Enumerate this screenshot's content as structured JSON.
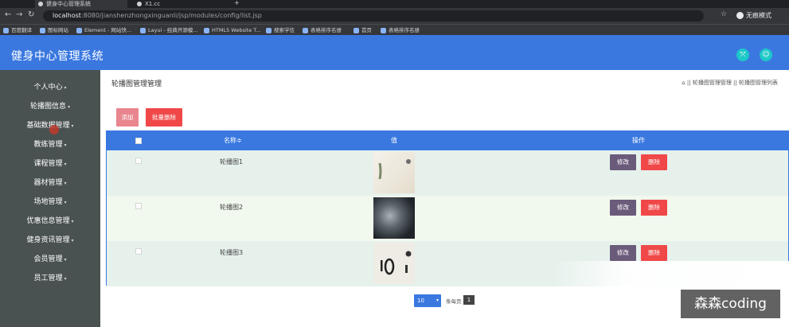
{
  "browser": {
    "tabs": [
      {
        "title": "健身中心管理系统",
        "active": true
      },
      {
        "title": "X1.cc",
        "active": false
      }
    ],
    "new_tab": "+",
    "url_host": "localhost",
    "url_path": ":8080/jianshenzhongxinguanli/jsp/modules/config/list.jsp",
    "incognito_label": "无痕模式",
    "bookmarks": [
      "百度翻译",
      "图标网站",
      "Element - 网站快...",
      "Layui - 经典开源模...",
      "HTML5 Website T...",
      "搜索学伍",
      "表格排序名册",
      "首页",
      "表格排序名册"
    ]
  },
  "header": {
    "title": "健身中心管理系统"
  },
  "sidebar": {
    "items": [
      {
        "label": "个人中心"
      },
      {
        "label": "轮播图信息"
      },
      {
        "label": "基础数据管理"
      },
      {
        "label": "教练管理"
      },
      {
        "label": "课程管理"
      },
      {
        "label": "器材管理"
      },
      {
        "label": "场地管理"
      },
      {
        "label": "优惠信息管理"
      },
      {
        "label": "健身资讯管理"
      },
      {
        "label": "会员管理"
      },
      {
        "label": "员工管理"
      }
    ]
  },
  "page": {
    "title": "轮播图管理管理",
    "breadcrumb": "⌂ || 轮播图管理管理 || 轮播图管理列表"
  },
  "toolbar": {
    "add_label": "添加",
    "batch_delete_label": "批量删除"
  },
  "table": {
    "headers": {
      "name": "名称≑",
      "value": "值",
      "action": "操作"
    },
    "rows": [
      {
        "name": "轮播图1",
        "edit": "修改",
        "delete": "删除"
      },
      {
        "name": "轮播图2",
        "edit": "修改",
        "delete": "删除"
      },
      {
        "name": "轮播图3",
        "edit": "修改",
        "delete": "删除"
      }
    ]
  },
  "pagination": {
    "page_size": "10",
    "page_size_label": "条每页",
    "current_page": "1"
  },
  "watermark": "森森coding",
  "colors": {
    "header_bg": "#3a78e0",
    "sidebar_bg": "#4a5151",
    "delete": "#f04848",
    "edit": "#6b5b7b"
  }
}
